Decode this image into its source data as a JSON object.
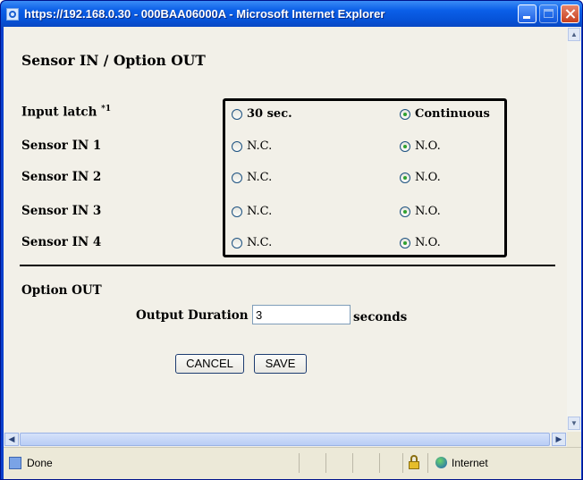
{
  "window": {
    "title": "https://192.168.0.30 - 000BAA06000A - Microsoft Internet Explorer"
  },
  "page": {
    "title": "Sensor IN / Option OUT",
    "rows": [
      {
        "label": "Input latch",
        "note": "*1",
        "option_a": "30 sec.",
        "option_b": "Continuous",
        "selected": "option_b"
      },
      {
        "label": "Sensor IN 1",
        "option_a": "N.C.",
        "option_b": "N.O.",
        "selected": "option_b"
      },
      {
        "label": "Sensor IN 2",
        "option_a": "N.C.",
        "option_b": "N.O.",
        "selected": "option_b"
      },
      {
        "label": "Sensor IN 3",
        "option_a": "N.C.",
        "option_b": "N.O.",
        "selected": "option_b"
      },
      {
        "label": "Sensor IN 4",
        "option_a": "N.C.",
        "option_b": "N.O.",
        "selected": "option_b"
      }
    ],
    "option_out": {
      "heading": "Option OUT",
      "duration_label": "Output Duration",
      "duration_value": "3",
      "duration_unit": "seconds"
    },
    "buttons": {
      "cancel": "CANCEL",
      "save": "SAVE"
    }
  },
  "status": {
    "left": "Done",
    "zone": "Internet"
  },
  "icons": [
    "ie-page-icon",
    "minimize-icon",
    "maximize-icon",
    "close-icon",
    "scroll-up-icon",
    "scroll-down-icon",
    "scroll-left-icon",
    "scroll-right-icon",
    "page-done-icon",
    "lock-icon",
    "globe-icon"
  ]
}
